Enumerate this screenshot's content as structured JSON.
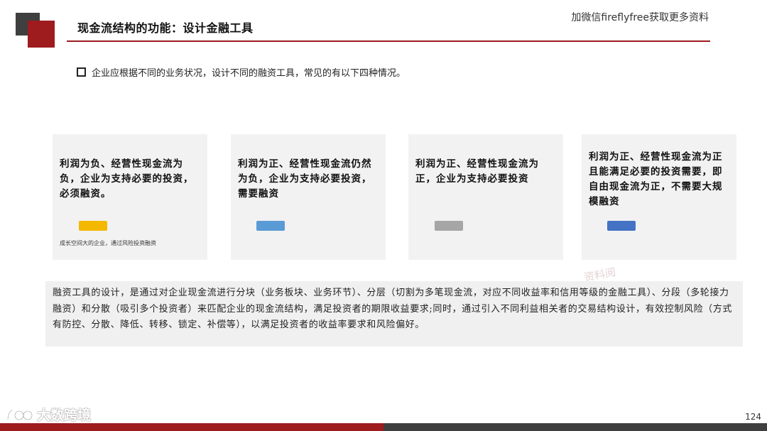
{
  "header": {
    "title": "现金流结构的功能：设计金融工具",
    "wechat_note": "加微信fireflyfree获取更多资料"
  },
  "intro": "企业应根据不同的业务状况，设计不同的融资工具，常见的有以下四种情况。",
  "cards": [
    {
      "text": "利润为负、经营性现金流为负，企业为支持必要的投资，必须融资。",
      "pill_color": "#f5b800",
      "note": "成长空间大的企业，通过风险投资融资"
    },
    {
      "text": "利润为正、经营性现金流仍然为负，企业为支持必要投资，需要融资",
      "pill_color": "#5b9bd5",
      "note": ""
    },
    {
      "text": "利润为正、经营性现金流为正，企业为支持必要投资",
      "pill_color": "#a6a6a6",
      "note": ""
    },
    {
      "text": "利润为正、经营性现金流为正且能满足必要的投资需要，即自由现金流为正，不需要大规模融资",
      "pill_color": "#4472c4",
      "note": ""
    }
  ],
  "summary": "融资工具的设计，是通过对企业现金流进行分块（业务板块、业务环节）、分层（切割为多笔现金流，对应不同收益率和信用等级的金融工具）、分段（多轮接力融资）和分散（吸引多个投资者）来匹配企业的现金流结构，满足投资者的期限收益要求;同时，通过引入不同利益相关者的交易结构设计，有效控制风险（方式有防控、分散、降低、转移、锁定、补偿等），以满足投资者的收益率要求和风险偏好。",
  "watermark": "资料阅",
  "footer": {
    "brand": "大数跨境",
    "page_number": "124"
  },
  "colors": {
    "accent_red": "#9e1b1e",
    "dark_gray": "#3f3f3f",
    "card_bg": "#f2f2f2"
  }
}
